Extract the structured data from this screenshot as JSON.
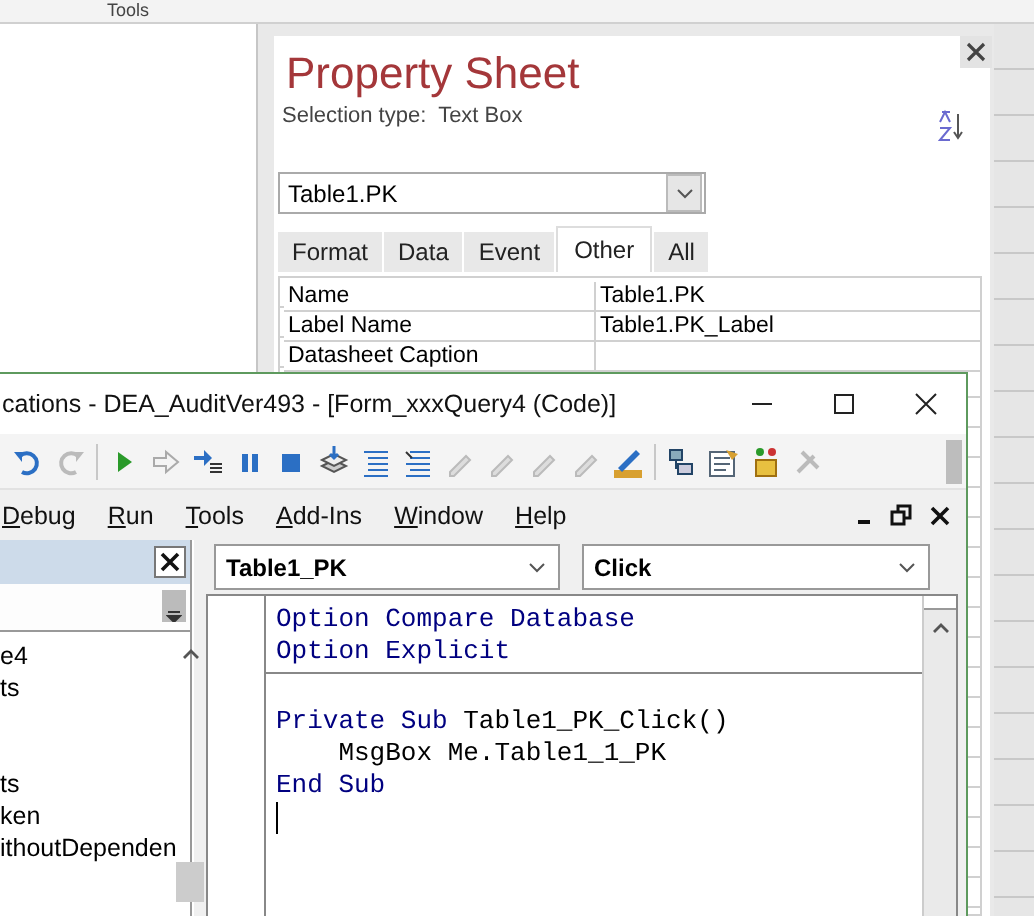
{
  "access": {
    "ribbon_group": "Tools"
  },
  "property_sheet": {
    "title": "Property Sheet",
    "selection_type_label": "Selection type:",
    "selection_type": "Text Box",
    "object_combo": "Table1.PK",
    "tabs": [
      {
        "label": "Format",
        "selected": false
      },
      {
        "label": "Data",
        "selected": false
      },
      {
        "label": "Event",
        "selected": false
      },
      {
        "label": "Other",
        "selected": true
      },
      {
        "label": "All",
        "selected": false
      }
    ],
    "rows": [
      {
        "property": "Name",
        "value": "Table1.PK"
      },
      {
        "property": "Label Name",
        "value": "Table1.PK_Label"
      },
      {
        "property": "Datasheet Caption"
      }
    ]
  },
  "vba_window": {
    "title": "cations - DEA_AuditVer493 - [Form_xxxQuery4 (Code)]",
    "menu": [
      "Debug",
      "Run",
      "Tools",
      "Add-Ins",
      "Window",
      "Help"
    ],
    "project_pane": {
      "items": [
        {
          "text": "e4"
        },
        {
          "text": "ts"
        },
        {
          "text": "ts"
        },
        {
          "text": "ken"
        },
        {
          "text": "ithoutDependen"
        }
      ]
    },
    "object_combo": "Table1_PK",
    "procedure_combo": "Click",
    "procedures": [
      {
        "lines": [
          [
            {
              "kind": "keyword",
              "text": "Option Compare Database"
            }
          ],
          [
            {
              "kind": "keyword",
              "text": "Option Explicit"
            }
          ]
        ]
      },
      {
        "lines": [
          [
            {
              "kind": "keyword",
              "text": "Private Sub "
            },
            {
              "kind": "plain",
              "text": "Table1_PK_Click()"
            }
          ],
          [
            {
              "kind": "plain",
              "text": "    MsgBox Me.Table1_1_PK"
            }
          ],
          [
            {
              "kind": "keyword",
              "text": "End Sub"
            }
          ]
        ]
      }
    ]
  }
}
